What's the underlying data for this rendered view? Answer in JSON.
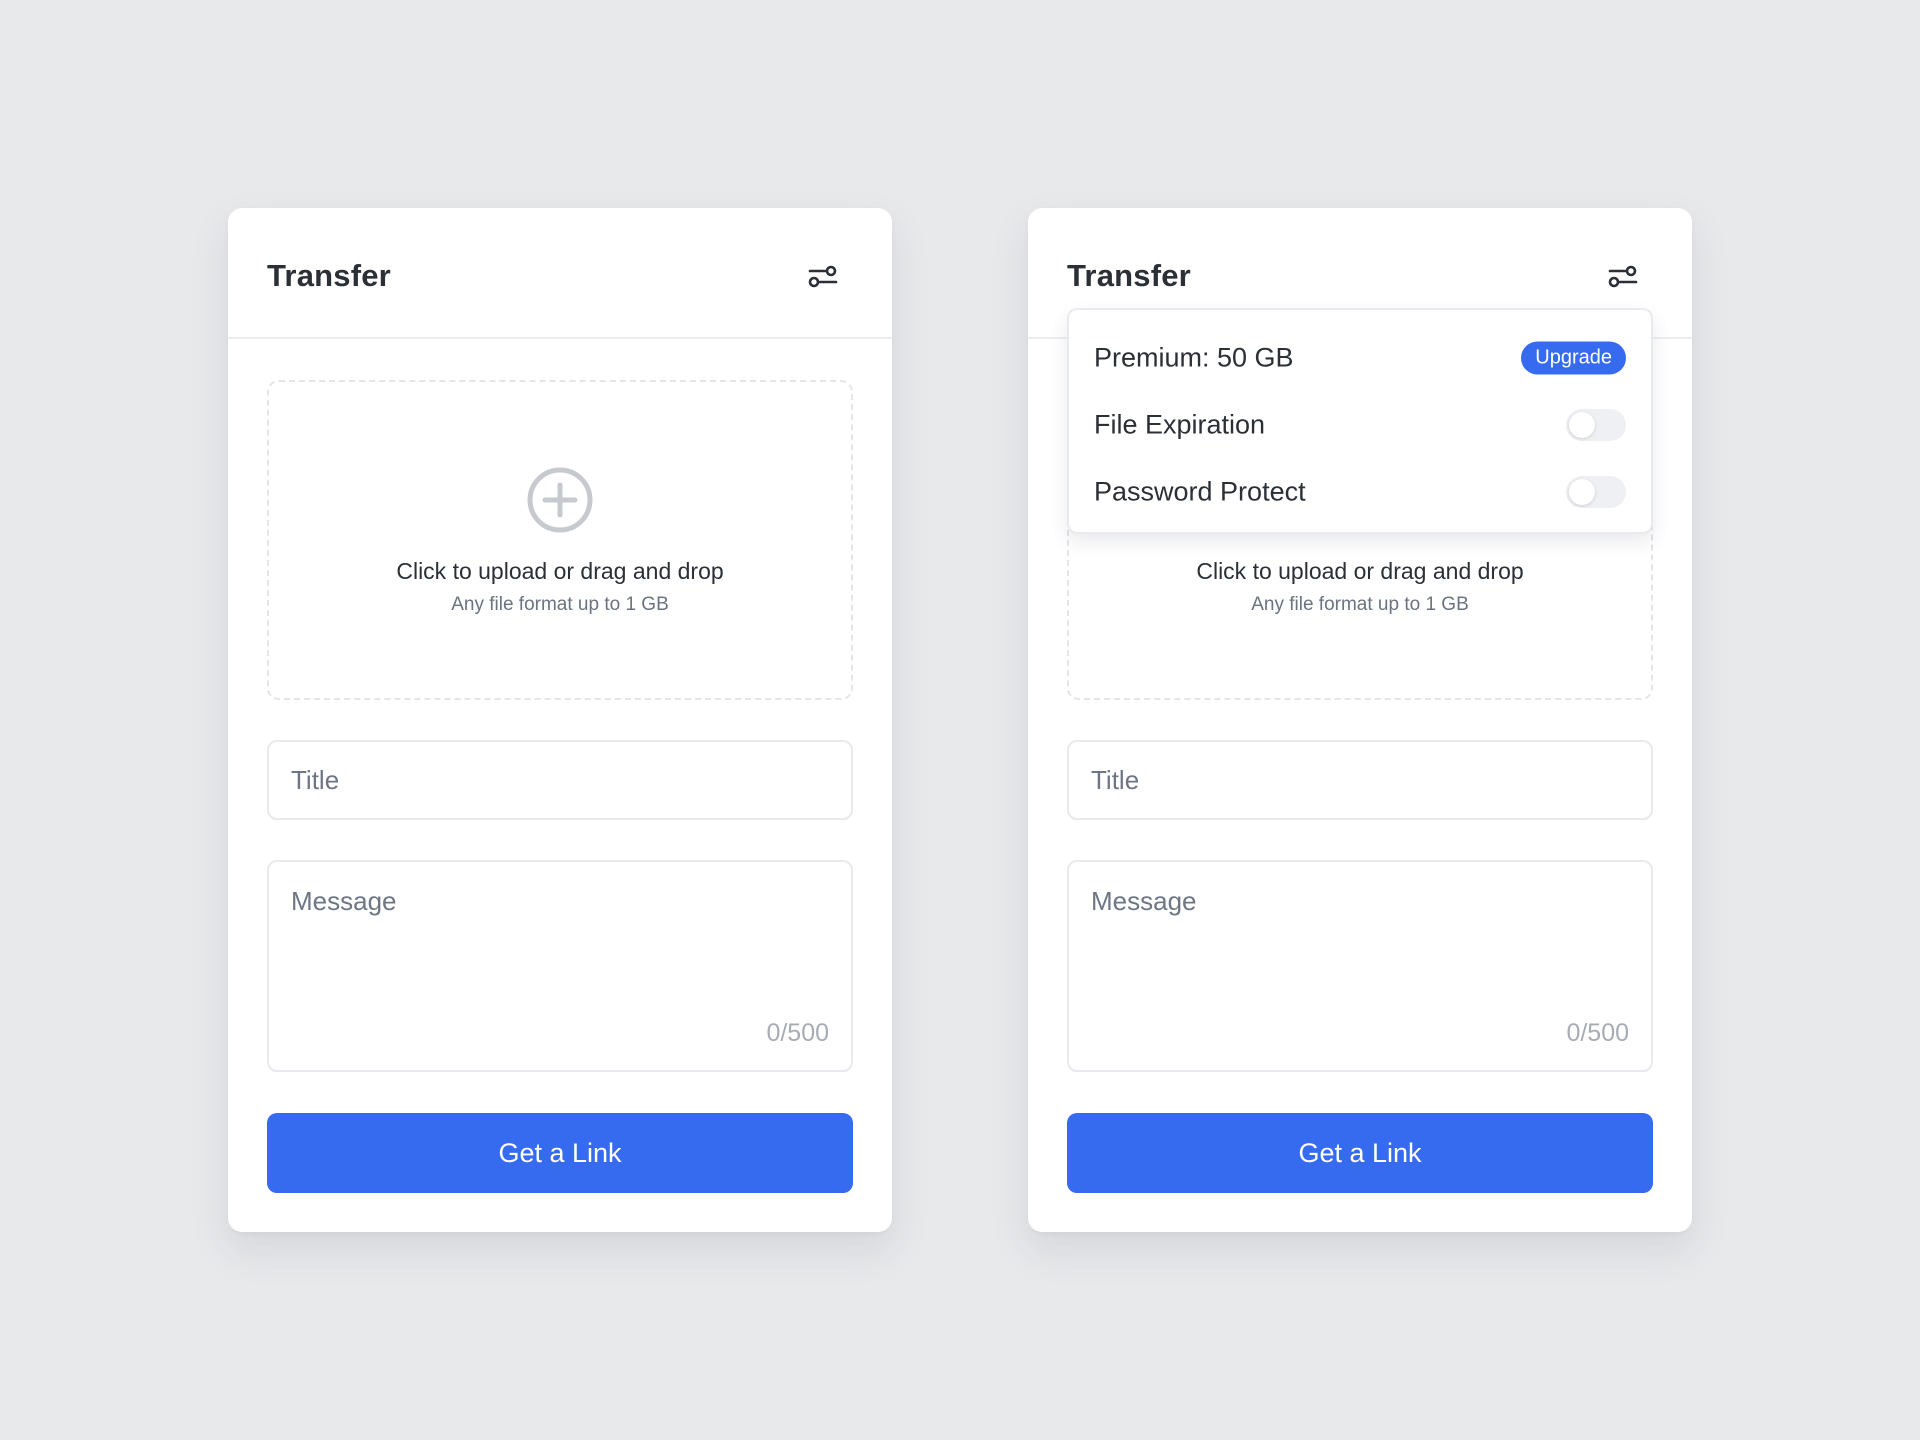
{
  "colors": {
    "background": "#e8e9eb",
    "card": "#ffffff",
    "accent": "#366bf0",
    "text": "#2b2f36",
    "muted": "#6b7380",
    "placeholder": "#6e7685",
    "counter": "#a6acb5"
  },
  "left_card": {
    "title": "Transfer",
    "settings_icon": "settings-sliders-icon",
    "dropzone": {
      "icon": "plus-circle-icon",
      "text": "Click to upload or drag and drop",
      "subtext": "Any file format up to 1 GB"
    },
    "title_field": {
      "placeholder": "Title",
      "value": ""
    },
    "message_field": {
      "placeholder": "Message",
      "value": "",
      "counter": "0/500"
    },
    "cta_label": "Get a Link"
  },
  "right_card": {
    "title": "Transfer",
    "settings_icon": "settings-sliders-icon",
    "dropdown": {
      "premium_label": "Premium: 50 GB",
      "upgrade_label": "Upgrade",
      "file_expiration_label": "File Expiration",
      "file_expiration_on": false,
      "password_protect_label": "Password Protect",
      "password_protect_on": false
    },
    "dropzone": {
      "text": "Click to upload or drag and drop",
      "subtext": "Any file format up to 1 GB"
    },
    "title_field": {
      "placeholder": "Title",
      "value": ""
    },
    "message_field": {
      "placeholder": "Message",
      "value": "",
      "counter": "0/500"
    },
    "cta_label": "Get a Link"
  }
}
